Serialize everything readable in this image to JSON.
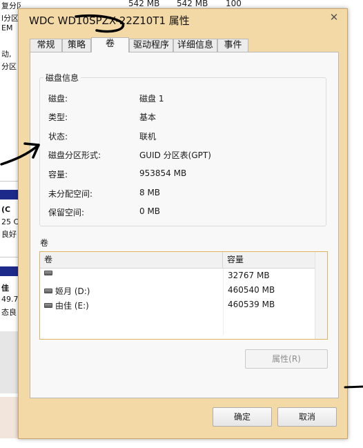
{
  "background": {
    "left_lines": [
      "复分区)",
      "l分区",
      "EM",
      "动,",
      "分区"
    ],
    "top_cells": [
      "542 MB",
      "542 MB",
      "100"
    ],
    "mid_lines": [
      "(C",
      "25 C",
      "良好"
    ],
    "lower_lines": [
      "佳",
      "49.7",
      "态良"
    ]
  },
  "dialog": {
    "title": "WDC WD10SPZX-22Z10T1 属性",
    "close_glyph": "✕",
    "tabs": [
      {
        "label": "常规"
      },
      {
        "label": "策略"
      },
      {
        "label": "卷"
      },
      {
        "label": "驱动程序"
      },
      {
        "label": "详细信息"
      },
      {
        "label": "事件"
      }
    ],
    "disk_info": {
      "title": "磁盘信息",
      "rows": [
        {
          "label": "磁盘:",
          "value": "磁盘 1"
        },
        {
          "label": "类型:",
          "value": "基本"
        },
        {
          "label": "状态:",
          "value": "联机"
        },
        {
          "label": "磁盘分区形式:",
          "value": "GUID 分区表(GPT)"
        },
        {
          "label": "容量:",
          "value": "953854 MB"
        },
        {
          "label": "未分配空间:",
          "value": "8 MB"
        },
        {
          "label": "保留空间:",
          "value": "0 MB"
        }
      ]
    },
    "volumes": {
      "title": "卷",
      "columns": [
        "卷",
        "容量"
      ],
      "rows": [
        {
          "name": "",
          "capacity": "32767 MB"
        },
        {
          "name": "姬月 (D:)",
          "capacity": "460540 MB"
        },
        {
          "name": "由佳 (E:)",
          "capacity": "460539 MB"
        }
      ]
    },
    "properties_button": "属性(R)",
    "ok_button": "确定",
    "cancel_button": "取消"
  },
  "icons": {
    "close": "close-icon",
    "drive": "drive-icon"
  }
}
